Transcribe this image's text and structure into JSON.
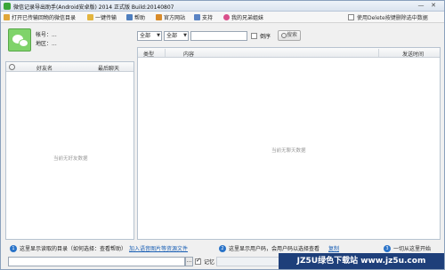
{
  "window": {
    "title": "微信记录导出助手(Android安卓版) 2014 正式版 Build:20140807",
    "minimize": "—",
    "close": "✕"
  },
  "menu": {
    "items": [
      {
        "label": "打开已传输回物的微信目录",
        "icon_color": "#e0a63a",
        "icon": "folder-icon"
      },
      {
        "label": "一键传输",
        "icon_color": "#e3b53f",
        "icon": "transfer-icon"
      },
      {
        "label": "帮助",
        "icon_color": "#4f7fbf",
        "icon": "help-icon"
      },
      {
        "label": "官方网站",
        "icon_color": "#d98b2a",
        "icon": "home-icon"
      },
      {
        "label": "支持",
        "icon_color": "#5b84c4",
        "icon": "support-icon"
      },
      {
        "label": "我的兄弟姐妹",
        "icon_color": "#d94f8a",
        "icon": "chrome-icon"
      }
    ],
    "delete_hint": "使用Delete按键删除选中数据"
  },
  "profile": {
    "account_label": "帐号：...",
    "region_label": "地区：..."
  },
  "friends": {
    "col_name": "好友名",
    "col_last": "最后聊天",
    "empty": "当前无好友数据"
  },
  "filters": {
    "type_select": "全部",
    "range_select": "全部",
    "search_placeholder": "",
    "reverse_label": "倒序",
    "search_button": "搜索"
  },
  "messages": {
    "col_type": "类型",
    "col_content": "内容",
    "col_time": "发送时间",
    "empty": "当前无聊天数据"
  },
  "bottom": {
    "tip1_num": "1",
    "tip1_text": "这里显示读取的目录（如何选择：查看帮助）",
    "tip1_link": "加入语音图片等资源文件",
    "tip2_num": "2",
    "tip2_text": "这里显示用户码，会用户码以选择查看",
    "tip2_link": "复制",
    "tip3_num": "3",
    "tip3_text": "一切从这里开始",
    "browse": "...",
    "remember_label": "记忆"
  },
  "watermark": "JZ5U绿色下载站 www.jz5u.com"
}
